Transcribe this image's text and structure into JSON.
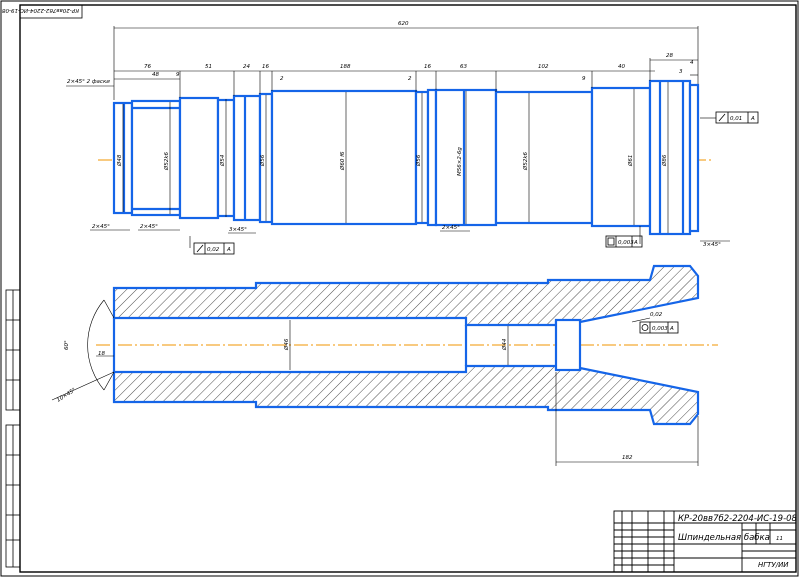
{
  "drawing_code_rotated": "КР-20вв7б2-2204-ИС-19-08",
  "title_block": {
    "designation": "КР-20вв7б2-2204-ИС-19-08",
    "part_name": "Шпиндельная бабка",
    "sheet": "11",
    "organization": "НГТУ/ИИ"
  },
  "dims_top": {
    "overall": "620",
    "d1": "76",
    "d2": "48",
    "d3": "9",
    "d4": "51",
    "d5": "24",
    "d6": "16",
    "d7": "2",
    "d8": "188",
    "d9": "2",
    "d10": "16",
    "d11": "63",
    "d12": "102",
    "d13": "9",
    "d14": "40",
    "d15": "28",
    "d16": "4",
    "d17": "3"
  },
  "diameters_top": [
    "Ø48",
    "Ø52k6",
    "Ø54",
    "Ø56",
    "Ø60 f6",
    "Ø56",
    "M56×2-6g",
    "Ø52k6",
    "Ø61",
    "Ø86"
  ],
  "notes_top": {
    "left_thread": "2×45° 2 фаски",
    "chamfer_a": "2×45°",
    "chamfer_b": "2×45°",
    "chamfer_c": "3×45°",
    "chamfer_d": "2×45°",
    "chamfer_e": "3×45°"
  },
  "tolerances": {
    "runout_right": "0,01",
    "runout_right_base": "А",
    "runout_bottom": "0,02",
    "runout_bottom_base": "А",
    "cyl_bottom": "0,003",
    "cyl_bottom_base": "А"
  },
  "section": {
    "angle": "60°",
    "d_left": "18",
    "d_bore": "Ø46",
    "d_bore2": "Ø44",
    "taper": "0,02",
    "taper_base": "А",
    "cone_tol": "0,003",
    "length_bottom": "182",
    "left_note": "10×45°"
  }
}
